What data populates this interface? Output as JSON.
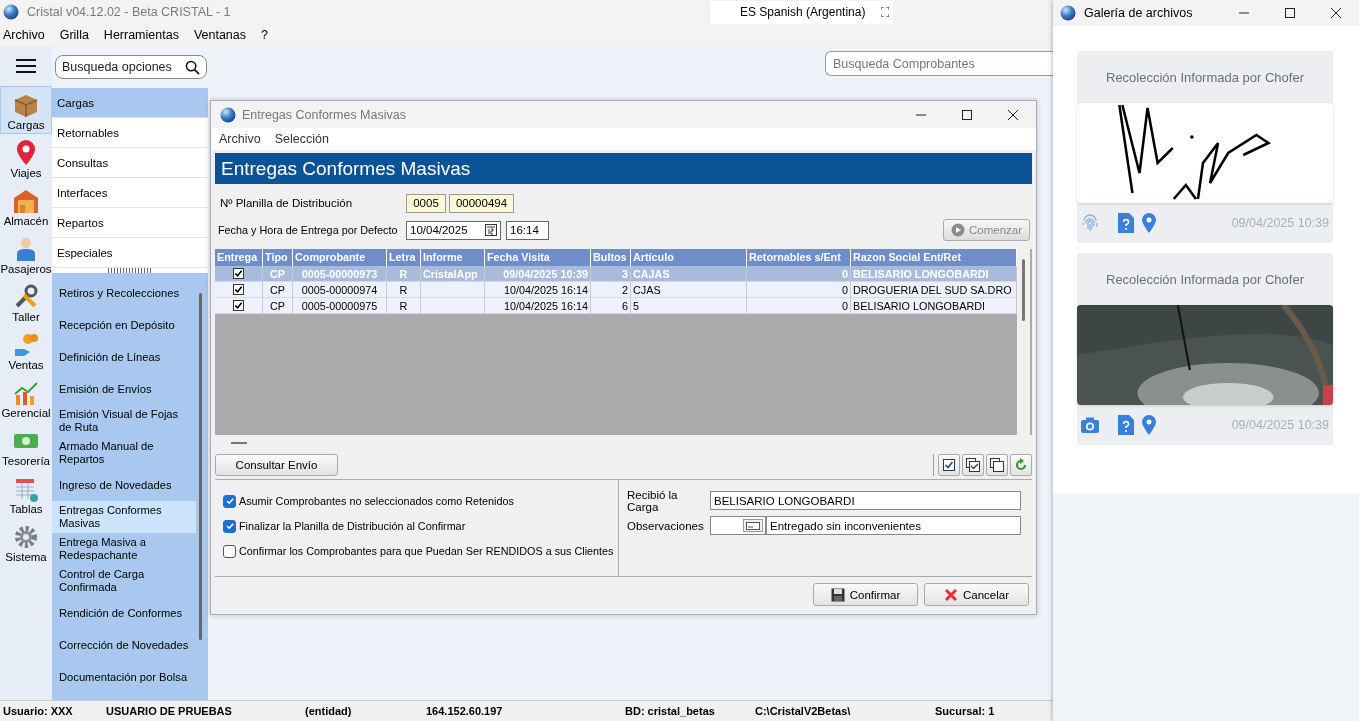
{
  "app": {
    "title": "Cristal v04.12.02 - Beta CRISTAL - 1",
    "language": "ES Spanish (Argentina)"
  },
  "menu": [
    "Archivo",
    "Grilla",
    "Herramientas",
    "Ventanas",
    "?"
  ],
  "search_options": {
    "placeholder": "Busqueda opciones"
  },
  "search_vouchers": {
    "placeholder": "Busqueda Comprobantes"
  },
  "modules": [
    {
      "label": "Cargas",
      "selected": true
    },
    {
      "label": "Viajes",
      "selected": false
    },
    {
      "label": "Almacén",
      "selected": false
    },
    {
      "label": "Pasajeros",
      "selected": false
    },
    {
      "label": "Taller",
      "selected": false
    },
    {
      "label": "Ventas",
      "selected": false
    },
    {
      "label": "Gerencial",
      "selected": false
    },
    {
      "label": "Tesorería",
      "selected": false
    },
    {
      "label": "Tablas",
      "selected": false
    },
    {
      "label": "Sistema",
      "selected": false
    }
  ],
  "categories": [
    {
      "label": "Cargas",
      "selected": true
    },
    {
      "label": "Retornables",
      "selected": false
    },
    {
      "label": "Consultas",
      "selected": false
    },
    {
      "label": "Interfaces",
      "selected": false
    },
    {
      "label": "Repartos",
      "selected": false
    },
    {
      "label": "Especiales",
      "selected": false
    }
  ],
  "submenu": [
    {
      "label": "Retiros y Recolecciones",
      "selected": false
    },
    {
      "label": "Recepción en Depósito",
      "selected": false
    },
    {
      "label": "Definición de Líneas",
      "selected": false
    },
    {
      "label": "Emisión de Envíos",
      "selected": false
    },
    {
      "label": "Emisión Visual de Fojas de Ruta",
      "selected": false
    },
    {
      "label": "Armado Manual de Repartos",
      "selected": false
    },
    {
      "label": "Ingreso de Novedades",
      "selected": false
    },
    {
      "label": "Entregas Conformes Masivas",
      "selected": true
    },
    {
      "label": "Entrega Masiva a Redespachante",
      "selected": false
    },
    {
      "label": "Control de Carga Confirmada",
      "selected": false
    },
    {
      "label": "Rendición de Conformes",
      "selected": false
    },
    {
      "label": "Corrección de Novedades",
      "selected": false
    },
    {
      "label": "Documentación por Bolsa",
      "selected": false
    }
  ],
  "dialog": {
    "title": "Entregas Conformes Masivas",
    "menu": [
      "Archivo",
      "Selección"
    ],
    "heading": "Entregas Conformes Masivas",
    "planilla": {
      "label": "Nº Planilla de Distribución",
      "series": "0005",
      "number": "00000494"
    },
    "default_date": {
      "label": "Fecha y Hora de Entrega por Defecto",
      "date": "10/04/2025",
      "time": "16:14"
    },
    "start_button": {
      "label": "Comenzar",
      "disabled": true
    },
    "table": {
      "columns": [
        "Entrega",
        "Tipo",
        "Comprobante",
        "Letra",
        "Informe",
        "Fecha Visita",
        "Bultos",
        "Artículo",
        "Retornables s/Ent",
        "Razon Social Ent/Ret"
      ],
      "rows": [
        {
          "selected": true,
          "checked": true,
          "tipo": "CP",
          "comprobante": "0005-00000973",
          "letra": "R",
          "informe": "CristalApp",
          "fecha": "09/04/2025 10:39",
          "bultos": "3",
          "articulo": "CAJAS",
          "retornables": "0",
          "razon": "BELISARIO LONGOBARDI"
        },
        {
          "selected": false,
          "checked": true,
          "tipo": "CP",
          "comprobante": "0005-00000974",
          "letra": "R",
          "fecha": "10/04/2025 16:14",
          "bultos": "2",
          "articulo": "CJAS",
          "retornables": "0",
          "razon": "DROGUERIA DEL SUD SA.DRO"
        },
        {
          "selected": false,
          "checked": true,
          "tipo": "CP",
          "comprobante": "0005-00000975",
          "letra": "R",
          "fecha": "10/04/2025 16:14",
          "bultos": "6",
          "articulo": "5",
          "retornables": "0",
          "razon": "BELISARIO LONGOBARDI"
        }
      ]
    },
    "consult_button": "Consultar Envío",
    "options": [
      {
        "label": "Asumir Comprobantes no seleccionados como Retenidos",
        "checked": true
      },
      {
        "label": "Finalizar la Planilla de Distribución al Confirmar",
        "checked": true
      },
      {
        "label": "Confirmar los Comprobantes para que Puedan Ser RENDIDOS a sus Clientes",
        "checked": false
      }
    ],
    "received_by": {
      "label": "Recibió la Carga",
      "value": "BELISARIO LONGOBARDI"
    },
    "observations": {
      "label": "Observaciones",
      "value": "Entregado sin inconvenientes"
    },
    "buttons": [
      "Confirmar",
      "Cancelar"
    ]
  },
  "gallery": {
    "title": "Galería de archivos",
    "cards": [
      {
        "title": "Recolección Informada por Chofer",
        "kind": "signature",
        "date": "09/04/2025 10:39"
      },
      {
        "title": "Recolección Informada por Chofer",
        "date": "09/04/2025 10:39"
      }
    ]
  },
  "status_bar": [
    "Usuario: XXX",
    "USUARIO DE PRUEBAS",
    "(entidad)",
    "164.152.60.197",
    "BD: cristal_betas",
    "C:\\CristalV2Betas\\",
    "Sucursal: 1"
  ]
}
